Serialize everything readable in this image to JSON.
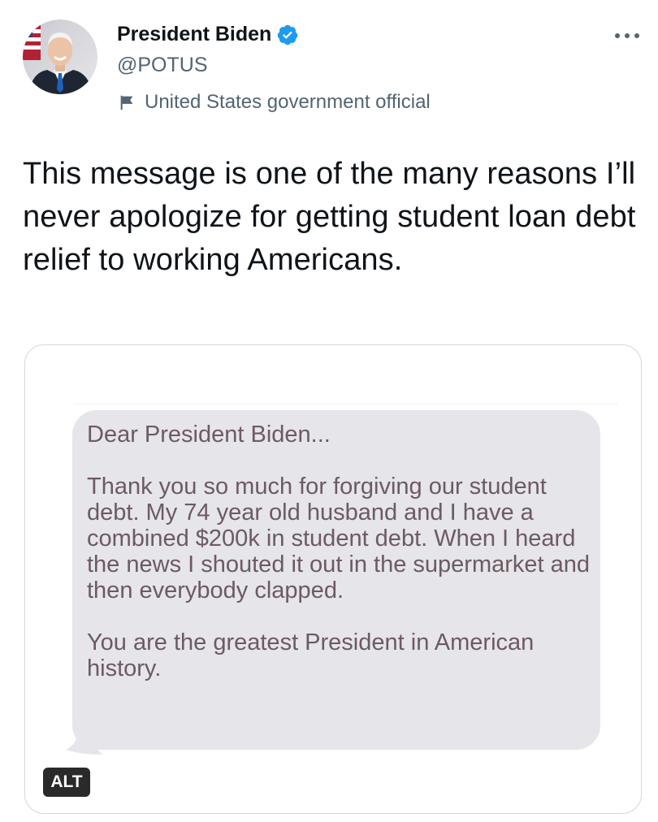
{
  "author": {
    "name": "President Biden",
    "handle": "@POTUS",
    "verified_icon": "verified-badge-icon",
    "label_icon": "flag-icon",
    "label": "United States government official"
  },
  "tweet": {
    "text": "This message is one of the many reasons I’ll never apologize for getting student loan debt relief to working Americans."
  },
  "media": {
    "message_greeting": "Dear President Biden...",
    "message_body": "Thank you so much for forgiving our student debt. My 74 year old husband and I have a combined $200k in student debt. When I heard the news I shouted it out in the supermarket and then everybody clapped.",
    "message_closing": "You are the greatest President in American history.",
    "alt_badge": "ALT"
  },
  "colors": {
    "verified": "#1d9bf0",
    "bubble": "#e5e5ea",
    "bubble_text": "#6d5a62",
    "secondary_text": "#536471"
  }
}
